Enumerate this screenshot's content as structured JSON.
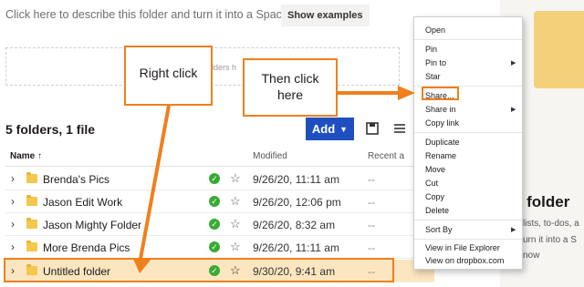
{
  "describe": {
    "text": "Click here to describe this folder and turn it into a Space",
    "button": "Show examples",
    "dropzone_fragment": "olders h"
  },
  "toolbar": {
    "count": "5 folders, 1 file",
    "add_label": "Add"
  },
  "table": {
    "headers": {
      "name": "Name",
      "modified": "Modified",
      "recent": "Recent a"
    },
    "rows": [
      {
        "name": "Brenda's Pics",
        "modified": "9/26/20, 11:11 am",
        "recent": "--"
      },
      {
        "name": "Jason Edit Work",
        "modified": "9/26/20, 12:06 pm",
        "recent": "--"
      },
      {
        "name": "Jason Mighty Folder",
        "modified": "9/26/20, 8:32 am",
        "recent": "--"
      },
      {
        "name": "More Brenda Pics",
        "modified": "9/26/20, 11:11 am",
        "recent": "--"
      },
      {
        "name": "Untitled folder",
        "modified": "9/30/20, 9:41 am",
        "recent": "--"
      }
    ]
  },
  "context_menu": {
    "items": [
      "Open",
      "Pin",
      "Pin to",
      "Star",
      "Share...",
      "Share in",
      "Copy link",
      "Duplicate",
      "Rename",
      "Move",
      "Cut",
      "Copy",
      "Delete",
      "Sort By",
      "View in File Explorer",
      "View on dropbox.com"
    ]
  },
  "side_panel": {
    "title": "d folder",
    "line1": "lists, to-dos, a",
    "line2": "urn it into a S",
    "line3": "now"
  },
  "callouts": {
    "right_click": "Right click",
    "then_click_1": "Then click",
    "then_click_2": "here"
  },
  "colors": {
    "accent": "#f07f1e",
    "add_button": "#1f4fbf",
    "selected_row": "#fbe6bf",
    "folder": "#f5c84c",
    "synced": "#3aaa35"
  }
}
